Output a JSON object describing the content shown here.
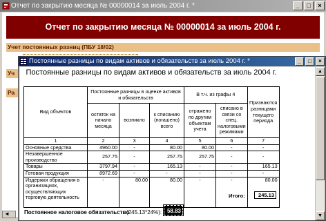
{
  "window_main": {
    "title": "Отчет по закрытию месяца № 00000014 за июль 2004 г.",
    "title_suffix": "*",
    "report_header": "Отчет по закрытию месяца № 00000014 за июль 2004 г.",
    "section_label": "Учет постоянных разниц (ПБУ 18/02)",
    "link_label": "• Учет постоянных разниц (ПБУ 18/02)",
    "stub1": "Уч",
    "stub2": "Ра"
  },
  "window_report": {
    "title": "Постоянные разницы по видам активов и обязательств за июль 2004 г.",
    "title_suffix": "*",
    "heading": "Постоянные разницы по видам активов и обязательств за июль 2004 г.",
    "col_object": "Вид объектов",
    "col_group_main": "Постоянные разницы в оценке активов и обязательств",
    "col_group_incl": "В т.ч. из графы 4",
    "col_balance": "остаток на начало месяца",
    "col_arose": "возникло",
    "col_writeoff": "к списанию (погашено) всего",
    "col_reflected": "отражено по другим объектам учета",
    "col_spec": "списано в связи со спец. налоговыми режимами",
    "col_recognized": "Признаются разницами текущего периода",
    "col_numbers": [
      "1",
      "2",
      "3",
      "4",
      "5",
      "6",
      "7"
    ],
    "rows": [
      [
        "Основные средства",
        "4960.00",
        "-",
        "80.00",
        "80.00",
        "-",
        "-"
      ],
      [
        "Незавершенное производство",
        "257.75",
        "-",
        "257.75",
        "257.75",
        "-",
        "-"
      ],
      [
        "Товары",
        "3797.94",
        "-",
        "165.13",
        "-",
        "-",
        "165.13"
      ],
      [
        "Готовая продукция",
        "8972.69",
        "-",
        "-",
        "-",
        "-",
        "-"
      ],
      [
        "Издержки обращения в организациях, осуществляющих торговую деятельность",
        "-",
        "80.00",
        "80.00",
        "-",
        "-",
        "80.00"
      ]
    ],
    "total_label": "Итого:",
    "total_value": "245.13",
    "tax_label": "Постоянное налоговое обязательство",
    "tax_calc": "(245.13*24%):",
    "tax_value": "58.83"
  }
}
